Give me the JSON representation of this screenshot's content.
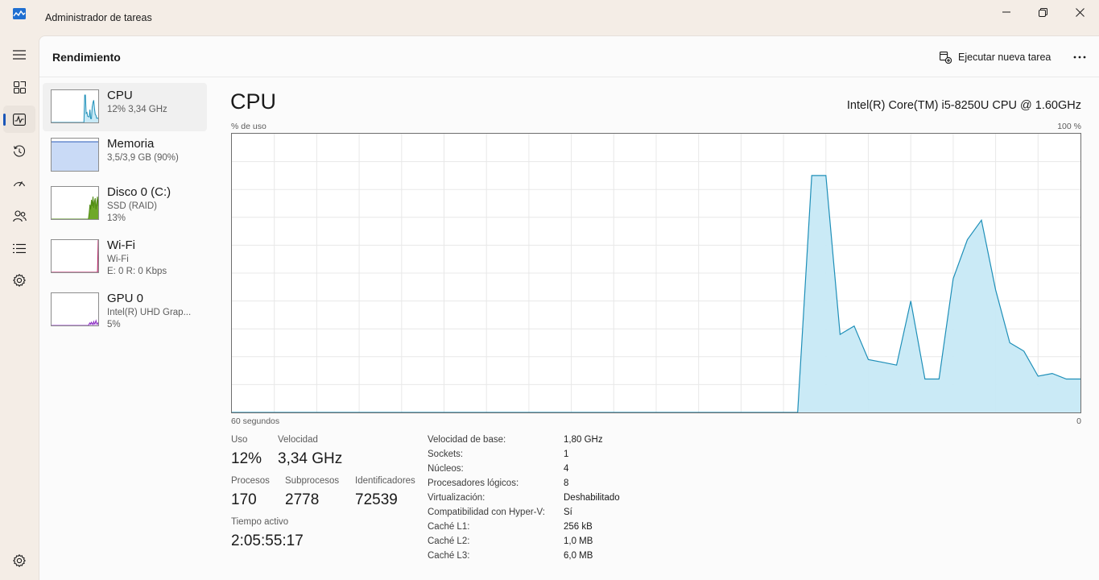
{
  "window": {
    "title": "Administrador de tareas",
    "icon": "task-manager-icon"
  },
  "header": {
    "title": "Rendimiento",
    "run_task_label": "Ejecutar nueva tarea"
  },
  "nav": [
    {
      "icon": "hamburger-menu-icon"
    },
    {
      "icon": "processes-icon"
    },
    {
      "icon": "performance-icon",
      "active": true
    },
    {
      "icon": "app-history-icon"
    },
    {
      "icon": "startup-apps-icon"
    },
    {
      "icon": "users-icon"
    },
    {
      "icon": "details-icon"
    },
    {
      "icon": "services-icon"
    },
    {
      "icon": "settings-icon"
    }
  ],
  "resources": [
    {
      "name": "CPU",
      "line1": "12% 3,34 GHz",
      "line2": "",
      "color": "#1e8fb8",
      "fill": "#c7e9f6",
      "values": [
        0,
        0,
        0,
        0,
        0,
        0,
        0,
        0,
        0,
        0,
        0,
        0,
        0,
        0,
        0,
        0,
        0,
        0,
        0,
        0,
        0,
        0,
        0,
        0,
        0,
        0,
        0,
        0,
        0,
        0,
        0,
        0,
        0,
        0,
        0,
        0,
        0,
        0,
        0,
        0,
        0,
        0,
        0,
        0,
        85,
        85,
        28,
        31,
        19,
        18,
        17,
        40,
        12,
        12,
        48,
        62,
        69,
        44,
        25,
        22,
        13,
        14,
        12
      ]
    },
    {
      "name": "Memoria",
      "line1": "3,5/3,9 GB (90%)",
      "line2": "",
      "color": "#2a5bb8",
      "fill": "#c9daf6",
      "values": [
        90,
        90,
        90,
        90,
        90,
        90,
        90,
        90,
        90,
        90,
        90,
        90,
        90,
        90,
        90,
        90,
        90,
        90,
        90,
        90,
        90,
        90,
        90,
        90,
        90,
        90,
        90,
        90,
        90,
        90,
        90,
        90,
        90,
        90,
        90,
        90,
        90,
        90,
        90,
        90,
        90,
        90,
        90,
        90,
        90,
        90,
        90,
        90,
        90,
        90,
        90,
        90,
        90,
        90,
        90,
        90,
        90,
        90,
        90,
        90,
        90,
        90,
        90
      ]
    },
    {
      "name": "Disco 0 (C:)",
      "line1": "SSD (RAID)",
      "line2": "13%",
      "color": "#4e8a11",
      "fill": "#6fa82a",
      "values": [
        0,
        0,
        0,
        0,
        0,
        0,
        0,
        0,
        0,
        0,
        0,
        0,
        0,
        0,
        0,
        0,
        0,
        0,
        0,
        0,
        0,
        0,
        0,
        0,
        0,
        0,
        0,
        0,
        0,
        0,
        0,
        0,
        0,
        0,
        0,
        0,
        0,
        0,
        0,
        0,
        0,
        0,
        0,
        0,
        0,
        0,
        0,
        0,
        0,
        0,
        20,
        45,
        30,
        60,
        40,
        70,
        35,
        55,
        65,
        30,
        50,
        70,
        40
      ]
    },
    {
      "name": "Wi-Fi",
      "line1": "Wi-Fi",
      "line2": "E: 0 R: 0 Kbps",
      "color": "#b1185e",
      "fill": "#e8b9cf",
      "values": [
        0,
        0,
        0,
        0,
        0,
        0,
        0,
        0,
        0,
        0,
        0,
        0,
        0,
        0,
        0,
        0,
        0,
        0,
        0,
        0,
        0,
        0,
        0,
        0,
        0,
        0,
        0,
        0,
        0,
        0,
        0,
        0,
        0,
        0,
        0,
        0,
        0,
        0,
        0,
        0,
        0,
        0,
        0,
        0,
        0,
        0,
        0,
        0,
        0,
        0,
        0,
        0,
        0,
        0,
        0,
        0,
        0,
        0,
        0,
        0,
        0,
        0,
        100
      ]
    },
    {
      "name": "GPU 0",
      "line1": "Intel(R) UHD Grap...",
      "line2": "5%",
      "color": "#8a2bc2",
      "fill": "#dfc6f0",
      "values": [
        0,
        0,
        0,
        0,
        0,
        0,
        0,
        0,
        0,
        0,
        0,
        0,
        0,
        0,
        0,
        0,
        0,
        0,
        0,
        0,
        0,
        0,
        0,
        0,
        0,
        0,
        0,
        0,
        0,
        0,
        0,
        0,
        0,
        0,
        0,
        0,
        0,
        0,
        0,
        0,
        0,
        0,
        0,
        0,
        0,
        0,
        0,
        0,
        0,
        0,
        5,
        8,
        4,
        10,
        6,
        3,
        12,
        5,
        8,
        15,
        6,
        4,
        10
      ]
    }
  ],
  "detail": {
    "title": "CPU",
    "model": "Intel(R) Core(TM) i5-8250U CPU @ 1.60GHz",
    "y_label": "% de uso",
    "y_max_label": "100 %",
    "x_left_label": "60 segundos",
    "x_right_label": "0"
  },
  "chart_data": {
    "type": "area",
    "title": "",
    "xlabel": "60 segundos",
    "ylabel": "% de uso",
    "xlim": [
      60,
      0
    ],
    "ylim": [
      0,
      100
    ],
    "grid": true,
    "color": "#1e8fb8",
    "fill": "#c7e9f6",
    "x": [
      60,
      59,
      58,
      57,
      56,
      55,
      54,
      53,
      52,
      51,
      50,
      49,
      48,
      47,
      46,
      45,
      44,
      43,
      42,
      41,
      40,
      39,
      38,
      37,
      36,
      35,
      34,
      33,
      32,
      31,
      30,
      29,
      28,
      27,
      26,
      25,
      24,
      23,
      22,
      21,
      20,
      19,
      18,
      17,
      16,
      15,
      14,
      13,
      12,
      11,
      10,
      9,
      8,
      7,
      6,
      5,
      4,
      3,
      2,
      1,
      0
    ],
    "values": [
      0,
      0,
      0,
      0,
      0,
      0,
      0,
      0,
      0,
      0,
      0,
      0,
      0,
      0,
      0,
      0,
      0,
      0,
      0,
      0,
      0,
      0,
      0,
      0,
      0,
      0,
      0,
      0,
      0,
      0,
      0,
      0,
      0,
      0,
      0,
      0,
      0,
      0,
      0,
      0,
      0,
      85,
      85,
      28,
      31,
      19,
      18,
      17,
      40,
      12,
      12,
      48,
      62,
      69,
      44,
      25,
      22,
      13,
      14,
      12,
      12
    ]
  },
  "stats": {
    "use_label": "Uso",
    "use_value": "12%",
    "speed_label": "Velocidad",
    "speed_value": "3,34 GHz",
    "processes_label": "Procesos",
    "processes_value": "170",
    "threads_label": "Subprocesos",
    "threads_value": "2778",
    "handles_label": "Identificadores",
    "handles_value": "72539",
    "uptime_label": "Tiempo activo",
    "uptime_value": "2:05:55:17"
  },
  "specs": [
    {
      "key": "Velocidad de base:",
      "value": "1,80 GHz"
    },
    {
      "key": "Sockets:",
      "value": "1"
    },
    {
      "key": "Núcleos:",
      "value": "4"
    },
    {
      "key": "Procesadores lógicos:",
      "value": "8"
    },
    {
      "key": "Virtualización:",
      "value": "Deshabilitado"
    },
    {
      "key": "Compatibilidad con Hyper-V:",
      "value": "Sí"
    },
    {
      "key": "Caché L1:",
      "value": "256 kB"
    },
    {
      "key": "Caché L2:",
      "value": "1,0 MB"
    },
    {
      "key": "Caché L3:",
      "value": "6,0 MB"
    }
  ]
}
